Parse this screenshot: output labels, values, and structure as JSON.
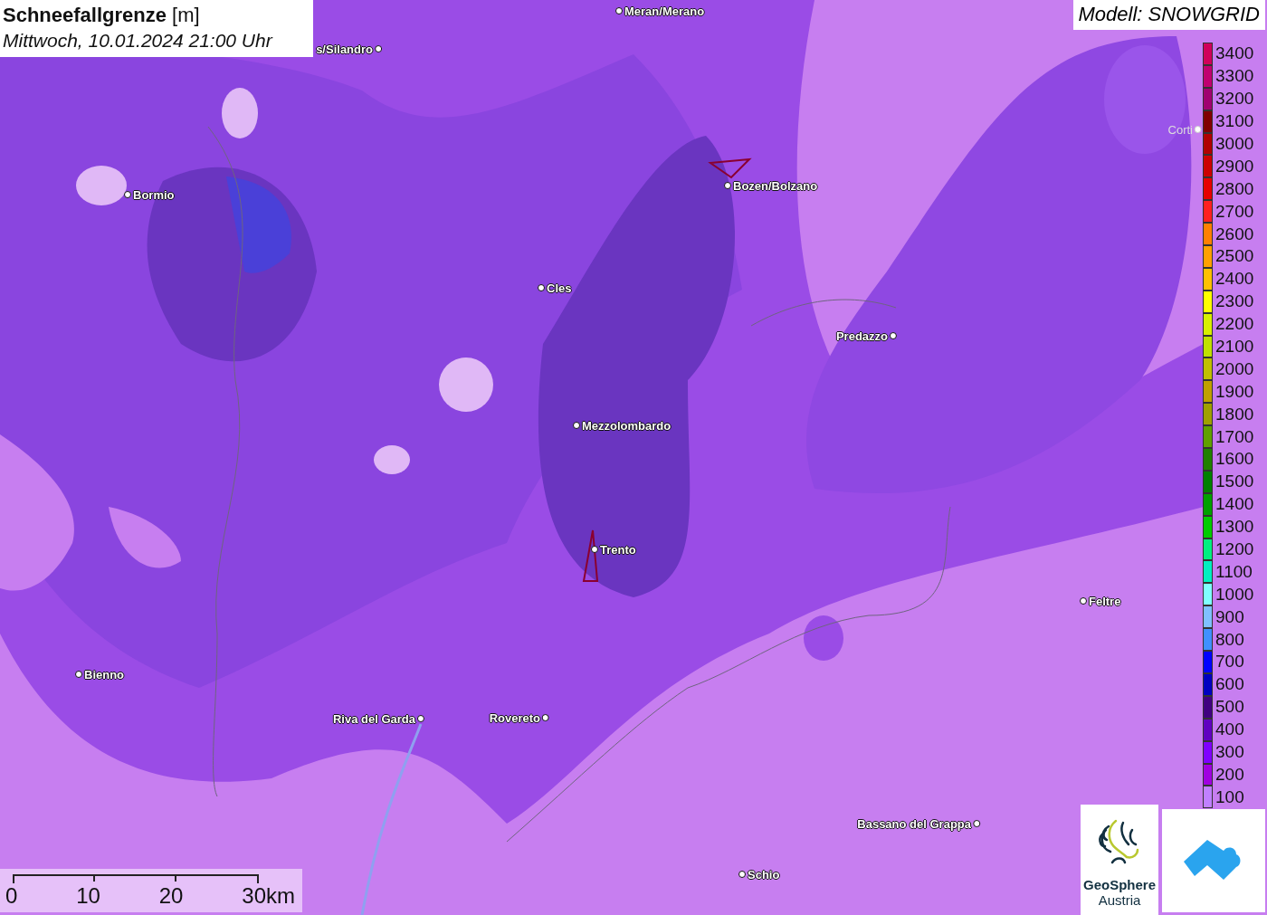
{
  "title": {
    "name": "Schneefallgrenze",
    "unit": "[m]",
    "time": "Mittwoch, 10.01.2024 21:00 Uhr"
  },
  "model": "Modell: SNOWGRID",
  "cities": [
    {
      "name": "Meran/Merano",
      "kind": "right"
    },
    {
      "name": "s/Silandro",
      "kind": "left"
    },
    {
      "name": "Bormio",
      "kind": "right"
    },
    {
      "name": "Bozen/Bolzano",
      "kind": "right"
    },
    {
      "name": "Cles",
      "kind": "right"
    },
    {
      "name": "Predazzo",
      "kind": "left"
    },
    {
      "name": "Mezzolombardo",
      "kind": "right"
    },
    {
      "name": "Trento",
      "kind": "right"
    },
    {
      "name": "Feltre",
      "kind": "right"
    },
    {
      "name": "Bienno",
      "kind": "right"
    },
    {
      "name": "Riva del Garda",
      "kind": "left"
    },
    {
      "name": "Rovereto",
      "kind": "left"
    },
    {
      "name": "Bassano del Grappa",
      "kind": "left"
    },
    {
      "name": "Schio",
      "kind": "right"
    },
    {
      "name": "Corti",
      "kind": "faded-left"
    }
  ],
  "legend": [
    {
      "label": "3400",
      "color": "#d0005a"
    },
    {
      "label": "3300",
      "color": "#c00070"
    },
    {
      "label": "3200",
      "color": "#a00070"
    },
    {
      "label": "3100",
      "color": "#800000"
    },
    {
      "label": "3000",
      "color": "#b00000"
    },
    {
      "label": "2900",
      "color": "#cc0000"
    },
    {
      "label": "2800",
      "color": "#e60000"
    },
    {
      "label": "2700",
      "color": "#ff2020"
    },
    {
      "label": "2600",
      "color": "#ff8000"
    },
    {
      "label": "2500",
      "color": "#ffa000"
    },
    {
      "label": "2400",
      "color": "#ffc000"
    },
    {
      "label": "2300",
      "color": "#ffff00"
    },
    {
      "label": "2200",
      "color": "#d8f000"
    },
    {
      "label": "2100",
      "color": "#c0e000"
    },
    {
      "label": "2000",
      "color": "#c0c000"
    },
    {
      "label": "1900",
      "color": "#c0a000"
    },
    {
      "label": "1800",
      "color": "#a0a000"
    },
    {
      "label": "1700",
      "color": "#60a000"
    },
    {
      "label": "1600",
      "color": "#208000"
    },
    {
      "label": "1500",
      "color": "#008000"
    },
    {
      "label": "1400",
      "color": "#00a000"
    },
    {
      "label": "1300",
      "color": "#00cc00"
    },
    {
      "label": "1200",
      "color": "#00f080"
    },
    {
      "label": "1100",
      "color": "#00f0c0"
    },
    {
      "label": "1000",
      "color": "#80ffff"
    },
    {
      "label": "900",
      "color": "#80c0ff"
    },
    {
      "label": "800",
      "color": "#4090ff"
    },
    {
      "label": "700",
      "color": "#0000ff"
    },
    {
      "label": "600",
      "color": "#0000c0"
    },
    {
      "label": "500",
      "color": "#400080"
    },
    {
      "label": "400",
      "color": "#6000c0"
    },
    {
      "label": "300",
      "color": "#8000ff"
    },
    {
      "label": "200",
      "color": "#a000e0"
    },
    {
      "label": "100",
      "color": "#c080ff"
    }
  ],
  "scale": [
    "0",
    "10",
    "20",
    "30km"
  ],
  "logo": {
    "line1": "GeoSphere",
    "line2": "Austria"
  }
}
